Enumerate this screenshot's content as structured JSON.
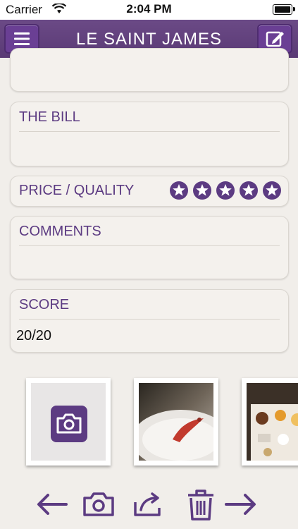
{
  "status_bar": {
    "carrier": "Carrier",
    "time": "2:04 PM"
  },
  "nav": {
    "title": "LE SAINT JAMES",
    "menu_icon": "hamburger-icon",
    "edit_icon": "compose-icon"
  },
  "sections": {
    "bill": {
      "label": "THE BILL",
      "value": ""
    },
    "price_quality": {
      "label": "PRICE / QUALITY",
      "rating": 5,
      "max": 5
    },
    "comments": {
      "label": "COMMENTS",
      "value": ""
    },
    "score": {
      "label": "SCORE",
      "value": "20/20"
    }
  },
  "photos": {
    "add_icon": "camera-icon",
    "items": [
      "plated-dish-photo",
      "dessert-tray-photo"
    ]
  },
  "toolbar": {
    "icons": [
      "back-arrow-icon",
      "camera-icon",
      "share-icon",
      "trash-icon",
      "forward-arrow-icon"
    ]
  },
  "colors": {
    "accent": "#5c3b82",
    "nav_bg": "#613f7d",
    "page_bg": "#f1eeea"
  }
}
